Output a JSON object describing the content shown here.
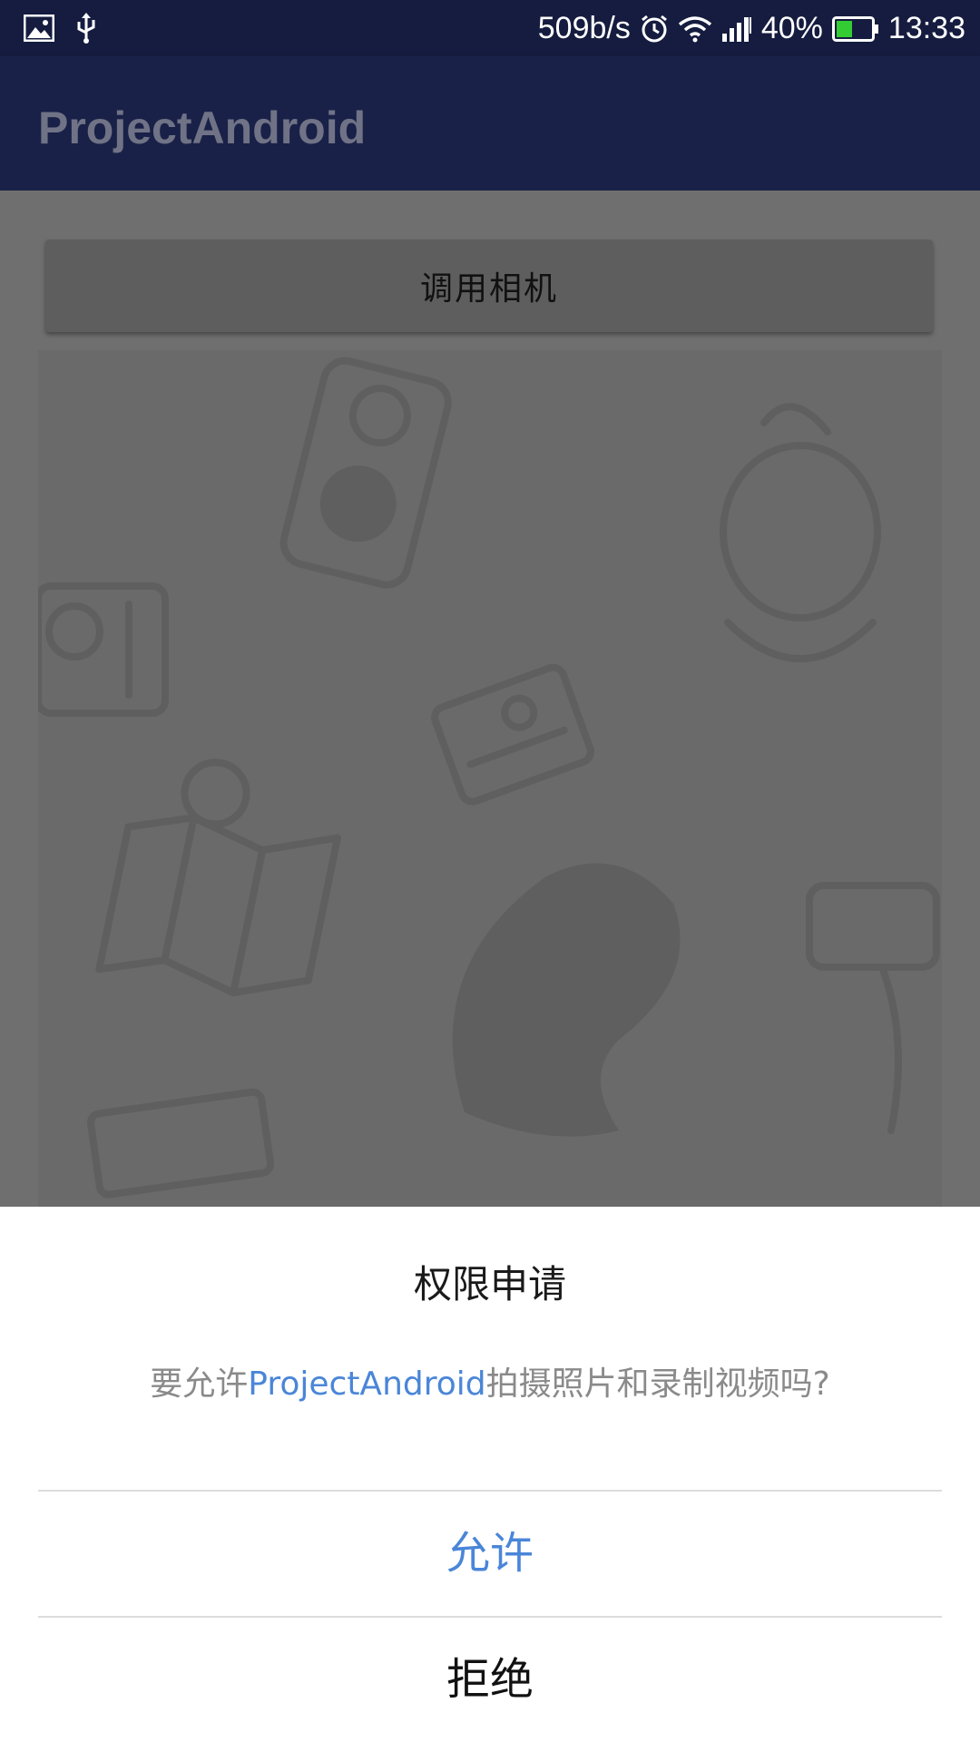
{
  "status_bar": {
    "left_icons": [
      "image-icon",
      "usb-icon"
    ],
    "net_speed": "509b/s",
    "battery_percent": "40%",
    "time": "13:33",
    "right_icons": [
      "alarm-icon",
      "wifi-icon",
      "signal-icon",
      "battery-icon"
    ],
    "battery_color": "#33cc33"
  },
  "app_bar": {
    "title": "ProjectAndroid"
  },
  "content": {
    "camera_button_label": "调用相机"
  },
  "dialog": {
    "title": "权限申请",
    "message_prefix": "要允许",
    "message_app": "ProjectAndroid",
    "message_suffix": "拍摄照片和录制视频吗?",
    "allow_label": "允许",
    "deny_label": "拒绝"
  },
  "colors": {
    "status_bar": "#151c3f",
    "app_bar": "#1a2148",
    "accent": "#4a86d8",
    "scrim": "#6b6b6b"
  }
}
